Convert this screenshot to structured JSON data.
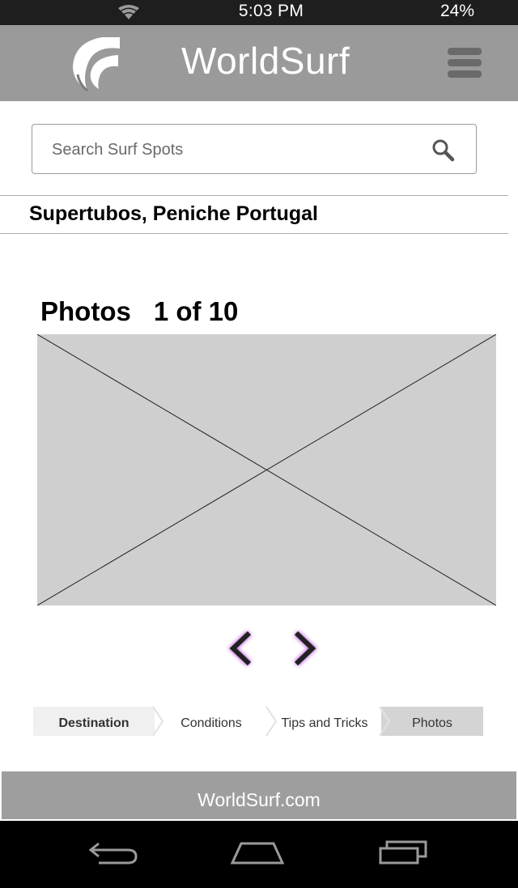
{
  "status_bar": {
    "time": "5:03 PM",
    "battery": "24%",
    "wifi_icon": "wifi-icon"
  },
  "header": {
    "title": "WorldSurf",
    "logo_icon": "wave-logo-icon",
    "menu_icon": "hamburger-menu-icon"
  },
  "search": {
    "placeholder": "Search Surf Spots",
    "icon": "search-icon"
  },
  "location": {
    "name": "Supertubos, Peniche Portugal"
  },
  "photos": {
    "heading": "Photos",
    "counter": "1 of 10",
    "prev_icon": "chevron-left-icon",
    "next_icon": "chevron-right-icon"
  },
  "steps": [
    {
      "label": "Destination"
    },
    {
      "label": "Conditions"
    },
    {
      "label": "Tips and Tricks"
    },
    {
      "label": "Photos"
    }
  ],
  "footer": {
    "site": "WorldSurf.com"
  },
  "nav_bar": {
    "back_icon": "back-icon",
    "home_icon": "home-icon",
    "recents_icon": "recents-icon"
  },
  "colors": {
    "header_bg": "#9a9a9a",
    "status_bg": "#1e1e1e",
    "footer_bg": "#9e9e9e",
    "arrow_glow": "#c060e0"
  }
}
